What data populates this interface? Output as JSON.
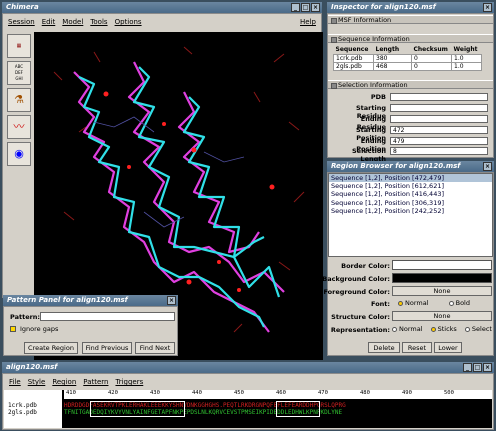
{
  "chimera": {
    "title": "Chimera",
    "menu": [
      "Session",
      "Edit",
      "Model",
      "Tools",
      "Options"
    ],
    "help": "Help",
    "tools": [
      "Alignment\nSeq Viewer",
      "Attributes\nDefine Pts\nGroups Sel",
      "Vial",
      "Graph",
      "Eye"
    ]
  },
  "pattern_panel": {
    "title": "Pattern Panel for align120.msf",
    "pattern_label": "Pattern:",
    "pattern_value": "",
    "ignore_gaps": "Ignore gaps",
    "buttons": [
      "Create Region",
      "Find Previous",
      "Find Next"
    ]
  },
  "inspector": {
    "title": "Inspector for align120.msf",
    "msf_info": "MSF Information",
    "seq_info": "Sequence Information",
    "columns": [
      "Sequence",
      "Length",
      "Checksum",
      "Weight"
    ],
    "rows": [
      [
        "1crk.pdb",
        "380",
        "0",
        "1.0"
      ],
      [
        "2gls.pdb",
        "468",
        "0",
        "1.0"
      ]
    ],
    "sel_info": "Selection Information",
    "fields": [
      {
        "label": "PDB",
        "value": ""
      },
      {
        "label": "Starting Residue",
        "value": ""
      },
      {
        "label": "Ending Residue",
        "value": ""
      },
      {
        "label": "Starting Position",
        "value": "472"
      },
      {
        "label": "Ending Position",
        "value": "479"
      },
      {
        "label": "Selection Length",
        "value": "8"
      }
    ]
  },
  "region_browser": {
    "title": "Region Browser for align120.msf",
    "regions": [
      "Sequence [1,2], Position [472,479]",
      "Sequence [1,2], Position [612,621]",
      "Sequence [1,2], Position [416,443]",
      "Sequence [1,2], Position [306,319]",
      "Sequence [1,2], Position [242,252]"
    ],
    "border_color": "Border Color:",
    "background_color": "Background Color:",
    "foreground_color": "Foreground Color:",
    "foreground_value": "None",
    "font_label": "Font:",
    "font_options": [
      "Normal",
      "Bold"
    ],
    "structure_color": "Structure Color:",
    "structure_value": "None",
    "representation": "Representation:",
    "repr_options": [
      "Normal",
      "Sticks",
      "Select"
    ],
    "buttons": [
      "Delete",
      "Reset",
      "Lower"
    ],
    "colors": {
      "border": "#ffffff",
      "background": "#000000"
    }
  },
  "align": {
    "title": "align120.msf",
    "menu": [
      "File",
      "Style",
      "Region",
      "Pattern",
      "Triggers"
    ],
    "names": [
      "1crk.pdb",
      "2gls.pdb"
    ],
    "ruler": [
      "410",
      "420",
      "430",
      "440",
      "450",
      "460",
      "470",
      "480",
      "490",
      "500"
    ],
    "seq1": "HDRDDGDFASEKRVTPKLERHAKLEEEKKYSHNVDNKGGHGHS.PEQTLRKDRGNPQFEFLEFEARDDHPGRSLQPRG",
    "seq2": "TFNITGADEDQIYKVYVNLYAINFGETAPFNKPEPDSLNLKQRVCEVSTPMSEIKPIDEDDLEDHWLKPNPKDLYNE"
  }
}
